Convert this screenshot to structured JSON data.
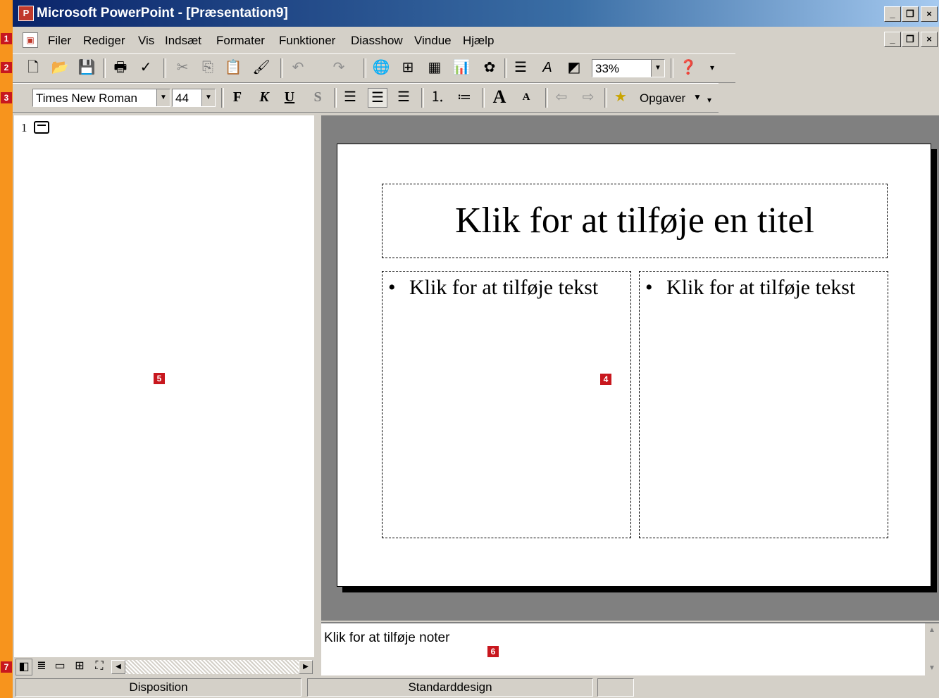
{
  "titlebar": {
    "app_icon": "P",
    "title": "Microsoft PowerPoint - [Præsentation9]",
    "min": "_",
    "max": "❐",
    "close": "×"
  },
  "menubar": {
    "items": [
      "Filer",
      "Rediger",
      "Vis",
      "Indsæt",
      "Formater",
      "Funktioner",
      "Diasshow",
      "Vindue",
      "Hjælp"
    ]
  },
  "standard_toolbar": {
    "icons": [
      "new-icon",
      "open-icon",
      "save-icon",
      "print-icon",
      "spellcheck-icon",
      "cut-icon",
      "copy-icon",
      "paste-icon",
      "format-painter-icon",
      "undo-icon",
      "redo-icon",
      "web-icon",
      "table-icon",
      "columns-icon",
      "chart-icon",
      "clipart-icon",
      "expand-icon",
      "font-shadow-icon",
      "grayscale-icon",
      "help-icon"
    ],
    "zoom": "33%"
  },
  "format_toolbar": {
    "font": "Times New Roman",
    "size": "44",
    "bold": "F",
    "italic": "K",
    "underline": "U",
    "shadow": "S",
    "tasks": "Opgaver"
  },
  "outline": {
    "slide_number": "1"
  },
  "slide": {
    "title": "Klik for at tilføje en titel",
    "left_text": "Klik for at tilføje tekst",
    "right_text": "Klik for at tilføje tekst",
    "bullet": "•"
  },
  "notes": {
    "text": "Klik for at tilføje noter"
  },
  "statusbar": {
    "left": "Disposition",
    "middle": "Standarddesign"
  },
  "badges": [
    "1",
    "2",
    "3",
    "4",
    "5",
    "6",
    "7"
  ]
}
